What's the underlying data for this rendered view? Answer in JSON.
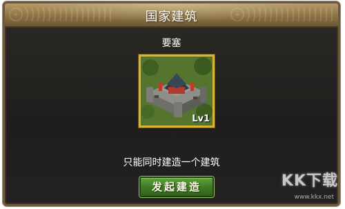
{
  "dialog": {
    "title": "国家建筑",
    "building_name": "要塞",
    "building_icon": "fortress-icon",
    "level": "Lv1",
    "notice": "只能同时建造一个建筑",
    "start_button": "发起建造"
  },
  "watermark": {
    "logo": "KK下载",
    "url": "www.kkx.net"
  },
  "colors": {
    "title_bar": "#8d7446",
    "portrait_border": "#d9b335",
    "button": "#3f7d25"
  }
}
